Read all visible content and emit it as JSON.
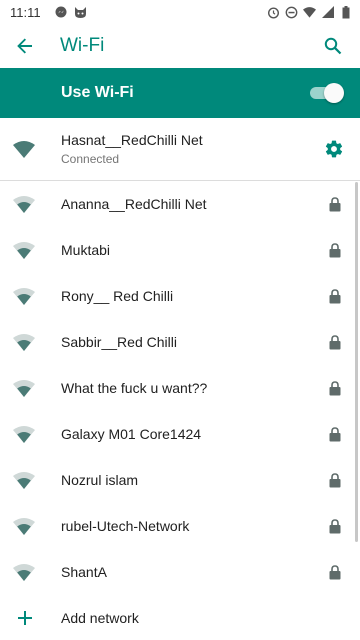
{
  "status_bar": {
    "time": "11:11",
    "left_icons": [
      "messenger-icon",
      "cat-icon"
    ],
    "right_icons": [
      "alarm-icon",
      "dnd-icon",
      "wifi-icon",
      "signal-icon",
      "battery-icon"
    ]
  },
  "app_bar": {
    "title": "Wi-Fi",
    "back_icon": "arrow-back-icon",
    "search_icon": "search-icon"
  },
  "wifi_toggle": {
    "label": "Use Wi-Fi",
    "enabled": true
  },
  "connected_network": {
    "name": "Hasnat__RedChilli Net",
    "status": "Connected"
  },
  "networks": [
    {
      "ssid": "Ananna__RedChilli Net",
      "secured": true
    },
    {
      "ssid": "Muktabi",
      "secured": true
    },
    {
      "ssid": "Rony__ Red Chilli",
      "secured": true
    },
    {
      "ssid": "Sabbir__Red Chilli",
      "secured": true
    },
    {
      "ssid": "What the fuck u want??",
      "secured": true
    },
    {
      "ssid": "Galaxy M01 Core1424",
      "secured": true
    },
    {
      "ssid": "Nozrul islam",
      "secured": true
    },
    {
      "ssid": "rubel-Utech-Network",
      "secured": true
    },
    {
      "ssid": "ShantA",
      "secured": true
    }
  ],
  "add_network_label": "Add network",
  "colors": {
    "accent": "#00897B",
    "wifi_icon": "#4b7b76",
    "lock_icon": "#5f6b6a"
  }
}
